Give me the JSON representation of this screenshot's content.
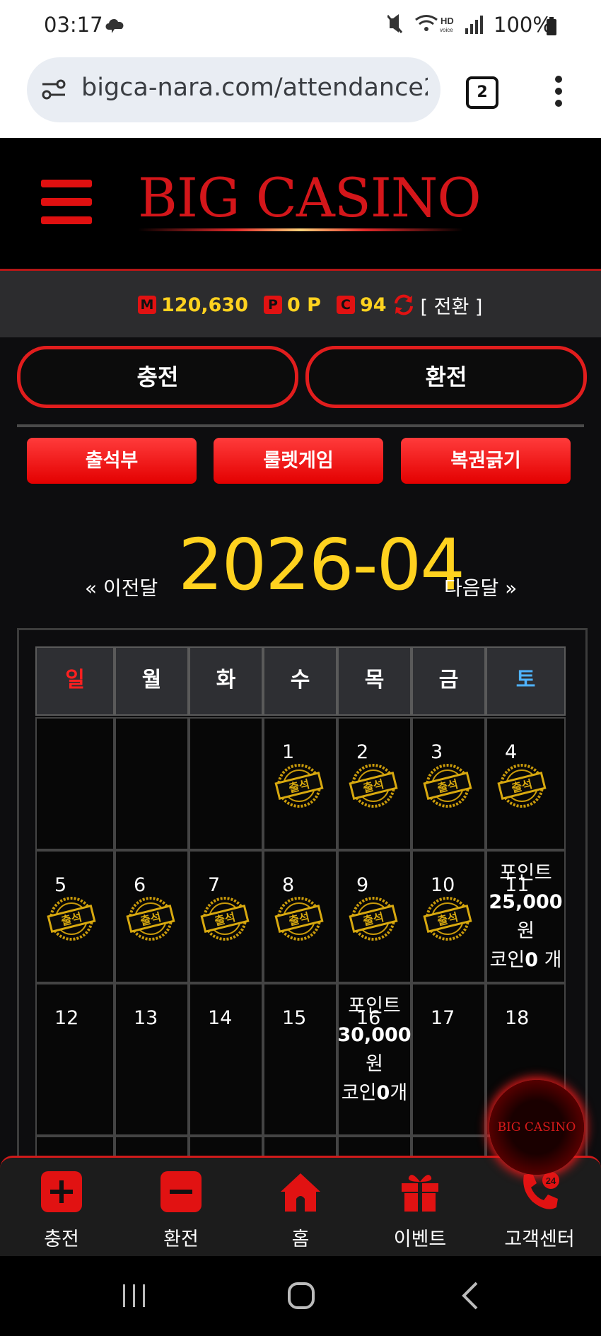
{
  "status_bar": {
    "time": "03:17",
    "battery": "100%"
  },
  "browser": {
    "url": "bigca-nara.com/attendance2",
    "tab_count": "2"
  },
  "header": {
    "logo": "BIG CASINO"
  },
  "balance": {
    "money_badge": "M",
    "money": "120,630",
    "point_badge": "P",
    "point": "0 P",
    "coin_badge": "C",
    "coin": "94",
    "switch_label": "[ 전환 ]"
  },
  "actions": {
    "charge": "충전",
    "exchange": "환전"
  },
  "menu": {
    "attendance": "출석부",
    "roulette": "룰렛게임",
    "lottery": "복권긁기"
  },
  "calendar": {
    "prev_label": "« 이전달",
    "month": "2026-04",
    "next_label": "다음달 »",
    "weekdays": [
      "일",
      "월",
      "화",
      "수",
      "목",
      "금",
      "토"
    ],
    "stamp_text": "출석",
    "days": [
      "1",
      "2",
      "3",
      "4",
      "5",
      "6",
      "7",
      "8",
      "9",
      "10",
      "11",
      "12",
      "13",
      "14",
      "15",
      "16",
      "17",
      "18"
    ],
    "attended_days": [
      1,
      2,
      3,
      4,
      5,
      6,
      7,
      8,
      9,
      10
    ],
    "reward_11": {
      "label": "포인트",
      "amount": "25,000",
      "unit": "원",
      "coin_label": "코인",
      "coin_value": "0",
      "coin_unit": " 개"
    },
    "reward_16": {
      "label": "포인트",
      "amount": "30,000",
      "unit": "원",
      "coin_label": "코인",
      "coin_value": "0",
      "coin_unit": "개"
    }
  },
  "floating_logo": "BIG CASINO",
  "bottom_nav": {
    "charge": "충전",
    "exchange": "환전",
    "home": "홈",
    "event": "이벤트",
    "support": "고객센터",
    "support_badge": "24"
  },
  "colors": {
    "accent_red": "#e11d1d",
    "gold": "#ffd21f",
    "sunday": "#ff2020",
    "saturday": "#4fb3ff"
  }
}
